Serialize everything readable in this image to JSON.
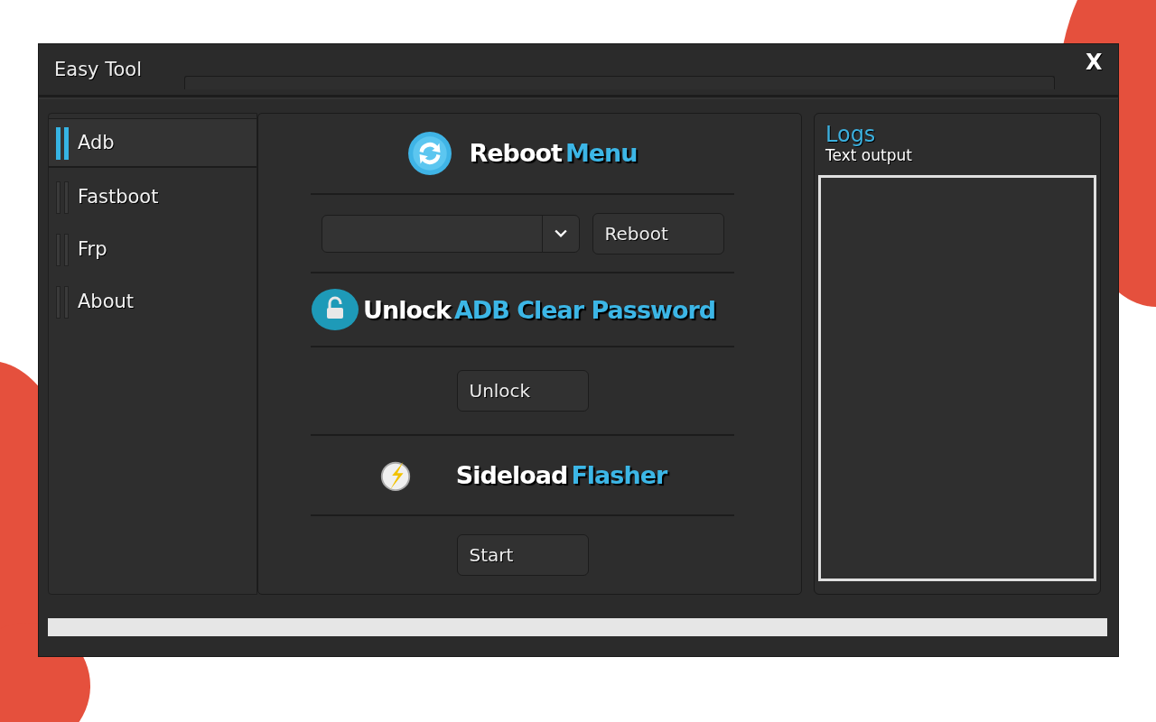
{
  "window": {
    "title": "Easy Tool",
    "close": "X"
  },
  "sidebar": {
    "items": [
      {
        "label": "Adb",
        "selected": true
      },
      {
        "label": "Fastboot",
        "selected": false
      },
      {
        "label": "Frp",
        "selected": false
      },
      {
        "label": "About",
        "selected": false
      }
    ]
  },
  "sections": [
    {
      "title": "Reboot",
      "accent": "Menu",
      "controls": [
        {
          "kind": "dropdown"
        },
        {
          "kind": "button",
          "label": "Reboot"
        }
      ]
    },
    {
      "title": "Unlock",
      "accent": "ADB Clear Password",
      "controls": [
        {
          "kind": "button",
          "label": "Unlock"
        }
      ]
    },
    {
      "title": "Sideload",
      "accent": "Flasher",
      "controls": [
        {
          "kind": "button",
          "label": "Start"
        }
      ]
    }
  ],
  "logs": {
    "title": "Logs",
    "subtitle": "Text output"
  },
  "progress": {
    "level": 0
  }
}
